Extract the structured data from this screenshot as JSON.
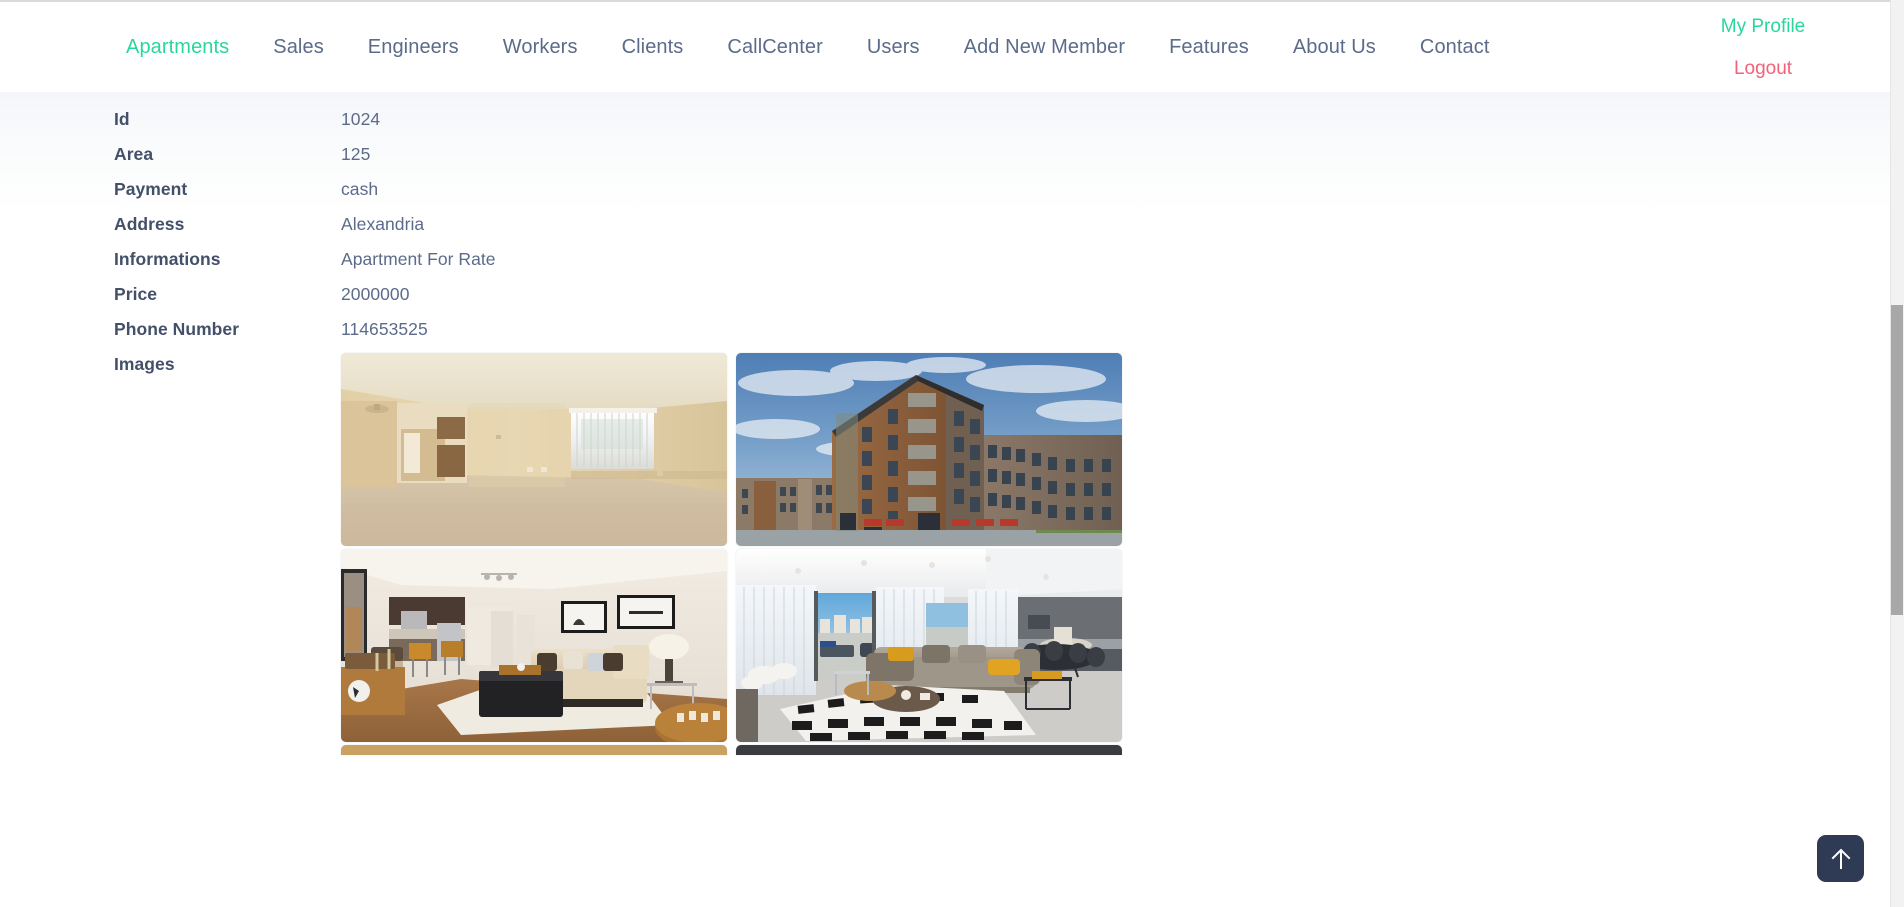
{
  "nav": {
    "items": [
      {
        "label": "Apartments",
        "active": true
      },
      {
        "label": "Sales",
        "active": false
      },
      {
        "label": "Engineers",
        "active": false
      },
      {
        "label": "Workers",
        "active": false
      },
      {
        "label": "Clients",
        "active": false
      },
      {
        "label": "CallCenter",
        "active": false
      },
      {
        "label": "Users",
        "active": false
      },
      {
        "label": "Add New Member",
        "active": false
      },
      {
        "label": "Features",
        "active": false
      },
      {
        "label": "About Us",
        "active": false
      },
      {
        "label": "Contact",
        "active": false
      }
    ],
    "profile_label": "My Profile",
    "logout_label": "Logout",
    "active_color": "#2ad79a",
    "link_color": "#5c6b8a",
    "logout_color": "#f4607a"
  },
  "details": {
    "rows": [
      {
        "label": "Id",
        "value": "1024"
      },
      {
        "label": "Area",
        "value": "125"
      },
      {
        "label": "Payment",
        "value": "cash"
      },
      {
        "label": "Address",
        "value": "Alexandria"
      },
      {
        "label": "Informations",
        "value": "Apartment For Rate"
      },
      {
        "label": "Price",
        "value": "2000000"
      },
      {
        "label": "Phone Number",
        "value": "114653525"
      }
    ],
    "images_label": "Images"
  },
  "images": [
    {
      "name": "empty-living-room-with-carpet",
      "alt": "Empty beige living room with carpet and window blinds"
    },
    {
      "name": "apartment-building-exterior",
      "alt": "Brick apartment building exterior under cloudy blue sky"
    },
    {
      "name": "furnished-living-room-with-kitchen",
      "alt": "Furnished living room with beige sofa, black ottoman and open kitchen"
    },
    {
      "name": "modern-luxury-living-room",
      "alt": "Modern living room with sheer curtains, gray sofa and geometric rug"
    }
  ],
  "scroll_top": {
    "icon": "arrow-up-icon",
    "background": "#2f3b54"
  }
}
